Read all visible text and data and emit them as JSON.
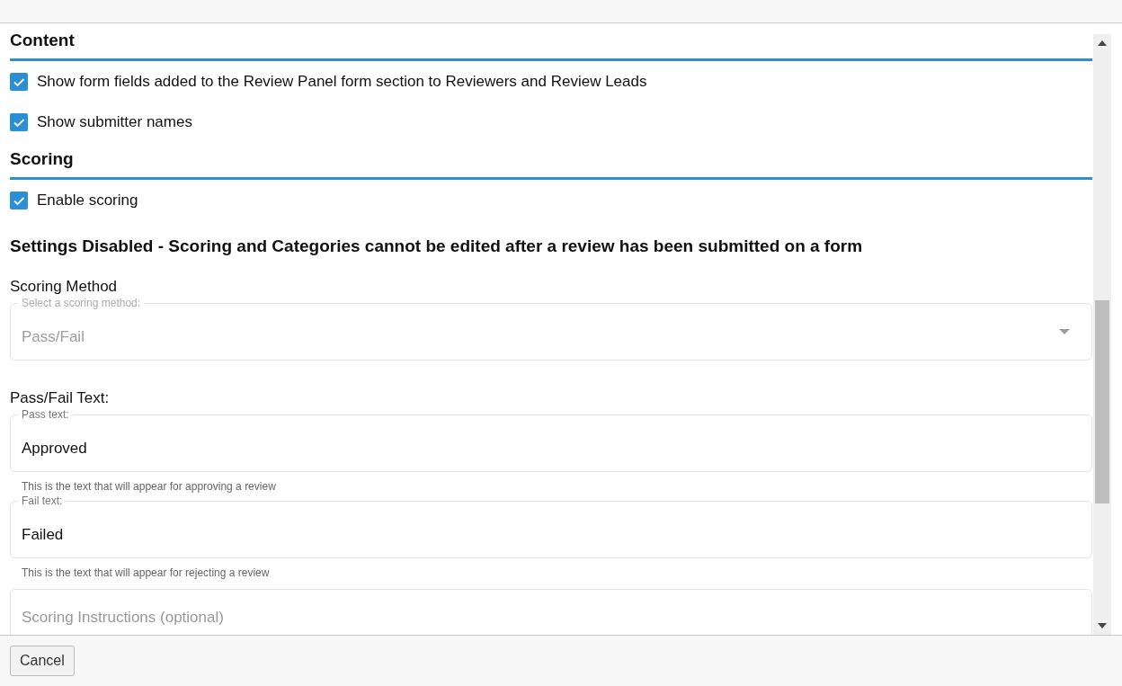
{
  "sections": [
    {
      "heading": "Content",
      "options": [
        {
          "label": "Show form fields added to the Review Panel form section to Reviewers and Review Leads",
          "checked": true
        },
        {
          "label": "Show submitter names",
          "checked": true
        }
      ]
    },
    {
      "heading": "Scoring",
      "options": [
        {
          "label": "Enable scoring",
          "checked": true
        }
      ]
    }
  ],
  "notice": "Settings Disabled - Scoring and Categories cannot be edited after a review has been submitted on a form",
  "scoring_method": {
    "label": "Scoring Method",
    "legend": "Select a scoring method:",
    "value": "Pass/Fail",
    "disabled": true
  },
  "pass_fail": {
    "label": "Pass/Fail Text:",
    "fields": [
      {
        "legend": "Pass text:",
        "value": "Approved",
        "help": "This is the text that will appear for approving a review"
      },
      {
        "legend": "Fail text:",
        "value": "Failed",
        "help": "This is the text that will appear for rejecting a review"
      }
    ]
  },
  "instructions": {
    "placeholder": "Scoring Instructions (optional)"
  },
  "buttons": [
    "Cancel"
  ]
}
